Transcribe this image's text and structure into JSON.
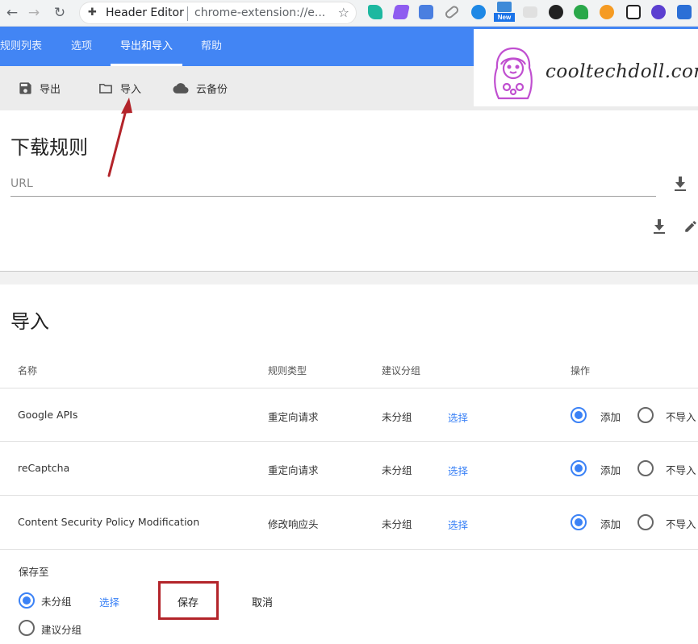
{
  "browser": {
    "tab_title": "Header Editor",
    "url": "chrome-extension://e...",
    "new_badge": "New"
  },
  "tabs": [
    {
      "label": "规则列表"
    },
    {
      "label": "选项"
    },
    {
      "label": "导出和导入",
      "active": true
    },
    {
      "label": "帮助"
    }
  ],
  "toolbar": {
    "export_label": "导出",
    "import_label": "导入",
    "backup_label": "云备份"
  },
  "watermark": "cooltechdoll.com",
  "download": {
    "title": "下载规则",
    "url_placeholder": "URL"
  },
  "import": {
    "title": "导入",
    "headers": {
      "name": "名称",
      "type": "规则类型",
      "group": "建议分组",
      "action": "操作"
    },
    "rows": [
      {
        "name": "Google APIs",
        "type": "重定向请求",
        "group": "未分组",
        "select": "选择",
        "add": "添加",
        "skip": "不导入"
      },
      {
        "name": "reCaptcha",
        "type": "重定向请求",
        "group": "未分组",
        "select": "选择",
        "add": "添加",
        "skip": "不导入"
      },
      {
        "name": "Content Security Policy Modification",
        "type": "修改响应头",
        "group": "未分组",
        "select": "选择",
        "add": "添加",
        "skip": "不导入"
      }
    ],
    "save_to_label": "保存至",
    "option_ungrouped": "未分组",
    "option_select": "选择",
    "option_suggested": "建议分组",
    "save_button": "保存",
    "cancel_button": "取消"
  },
  "colors": {
    "tab_bar": "#4285f4",
    "accent": "#3b82f6",
    "annotation": "#b3242a"
  }
}
